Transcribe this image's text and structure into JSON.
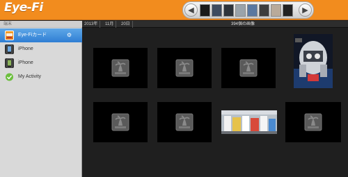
{
  "app": {
    "logo": "Eye-Fi"
  },
  "toolbar": {
    "prev_icon": "chevron-left-icon",
    "next_icon": "chevron-right-icon",
    "strip_colors": [
      "#1a1a1a",
      "#3e4b5f",
      "#2e343b",
      "#9aa3aa",
      "#5a78a0",
      "#3d3d3d",
      "#b9aa9a",
      "#222222"
    ]
  },
  "sidebar": {
    "header": "端末",
    "items": [
      {
        "label": "Eye-Fiカード",
        "active": true,
        "icon": "eyefi-card-icon"
      },
      {
        "label": "iPhone",
        "active": false,
        "icon": "iphone-icon"
      },
      {
        "label": "iPhone",
        "active": false,
        "icon": "iphone-icon"
      },
      {
        "label": "My Activity",
        "active": false,
        "icon": "activity-icon"
      }
    ],
    "settings_icon": "gear-icon"
  },
  "filter": {
    "year": "2013年",
    "month": "11月",
    "day": "20日",
    "count": "394個の画像"
  },
  "grid": {
    "tiles": [
      {
        "type": "placeholder",
        "icon": "image-placeholder-icon"
      },
      {
        "type": "placeholder",
        "icon": "image-placeholder-icon"
      },
      {
        "type": "placeholder",
        "icon": "image-placeholder-icon"
      },
      {
        "type": "photo",
        "subject": "robot"
      },
      {
        "type": "placeholder",
        "icon": "image-placeholder-icon"
      },
      {
        "type": "placeholder",
        "icon": "image-placeholder-icon"
      },
      {
        "type": "photo",
        "subject": "market"
      },
      {
        "type": "placeholder",
        "icon": "image-placeholder-icon"
      }
    ]
  }
}
